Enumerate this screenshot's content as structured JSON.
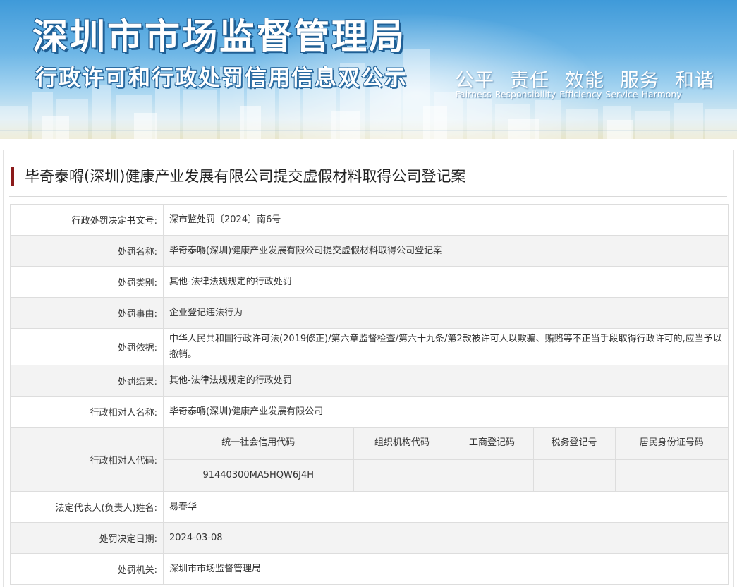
{
  "banner": {
    "title": "深圳市市场监督管理局",
    "subtitle": "行政许可和行政处罚信用信息双公示",
    "motto_cn": [
      "公平",
      "责任",
      "效能",
      "服务",
      "和谐"
    ],
    "motto_en": [
      "Fairness",
      "Responsibility",
      "Efficiency",
      "Service",
      "Harmony"
    ]
  },
  "case": {
    "title": "毕奇泰嘚(深圳)健康产业发展有限公司提交虚假材料取得公司登记案"
  },
  "fields": {
    "decision_no": {
      "label": "行政处罚决定书文号:",
      "value": "深市监处罚〔2024〕南6号"
    },
    "penalty_name": {
      "label": "处罚名称:",
      "value": "毕奇泰嘚(深圳)健康产业发展有限公司提交虚假材料取得公司登记案"
    },
    "penalty_type": {
      "label": "处罚类别:",
      "value": "其他-法律法规规定的行政处罚"
    },
    "reason": {
      "label": "处罚事由:",
      "value": "企业登记违法行为"
    },
    "basis": {
      "label": "处罚依据:",
      "value": "中华人民共和国行政许可法(2019修正)/第六章监督检查/第六十九条/第2款被许可人以欺骗、贿赂等不正当手段取得行政许可的,应当予以撤销。"
    },
    "result": {
      "label": "处罚结果:",
      "value": "其他-法律法规规定的行政处罚"
    },
    "party_name": {
      "label": "行政相对人名称:",
      "value": "毕奇泰嘚(深圳)健康产业发展有限公司"
    },
    "party_code": {
      "label": "行政相对人代码:",
      "headers": [
        "统一社会信用代码",
        "组织机构代码",
        "工商登记码",
        "税务登记号",
        "居民身份证号码"
      ],
      "values": [
        "91440300MA5HQW6J4H",
        "",
        "",
        "",
        ""
      ]
    },
    "legal_rep": {
      "label": "法定代表人(负责人)姓名:",
      "value": "易春华"
    },
    "decision_date": {
      "label": "处罚决定日期:",
      "value": "2024-03-08"
    },
    "authority": {
      "label": "处罚机关:",
      "value": "深圳市市场监督管理局"
    }
  }
}
